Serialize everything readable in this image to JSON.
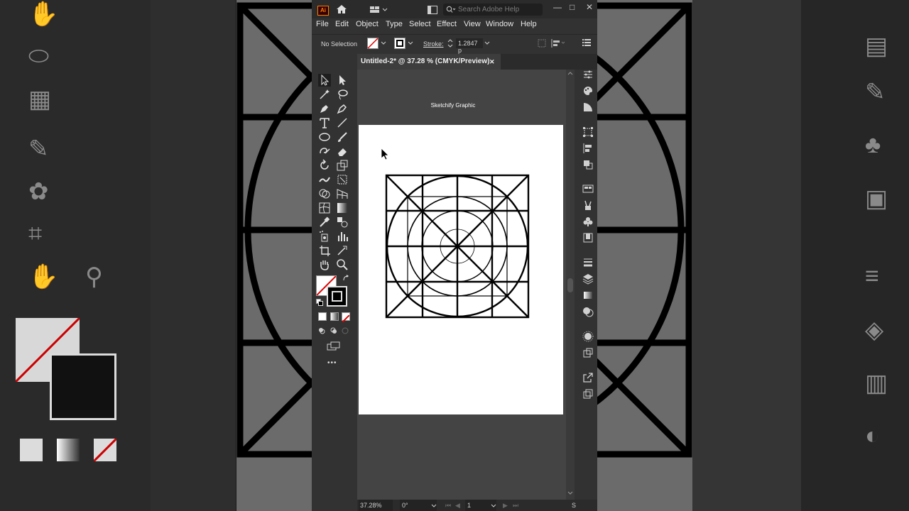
{
  "app": {
    "logo": "Ai",
    "search_placeholder": "Search Adobe Help",
    "window_controls": [
      "—",
      "□",
      "✕"
    ]
  },
  "menu": [
    "File",
    "Edit",
    "Object",
    "Type",
    "Select",
    "Effect",
    "View",
    "Window",
    "Help"
  ],
  "control_bar": {
    "selection": "No Selection",
    "stroke_label": "Stroke:",
    "stroke_value": "1.2847 p"
  },
  "document": {
    "tab_title": "Untitled-2* @ 37.28 % (CMYK/Preview)",
    "tab_close": "✕",
    "artboard_label": "Sketchify Graphic"
  },
  "status": {
    "zoom": "37.28%",
    "rotation": "0°",
    "artboard_number": "1",
    "menu_glyph": "S"
  },
  "toolbox": {
    "more_label": "•••"
  },
  "colors": {
    "accent": "#ff7c00",
    "panel": "#323232",
    "canvas": "#444444"
  }
}
